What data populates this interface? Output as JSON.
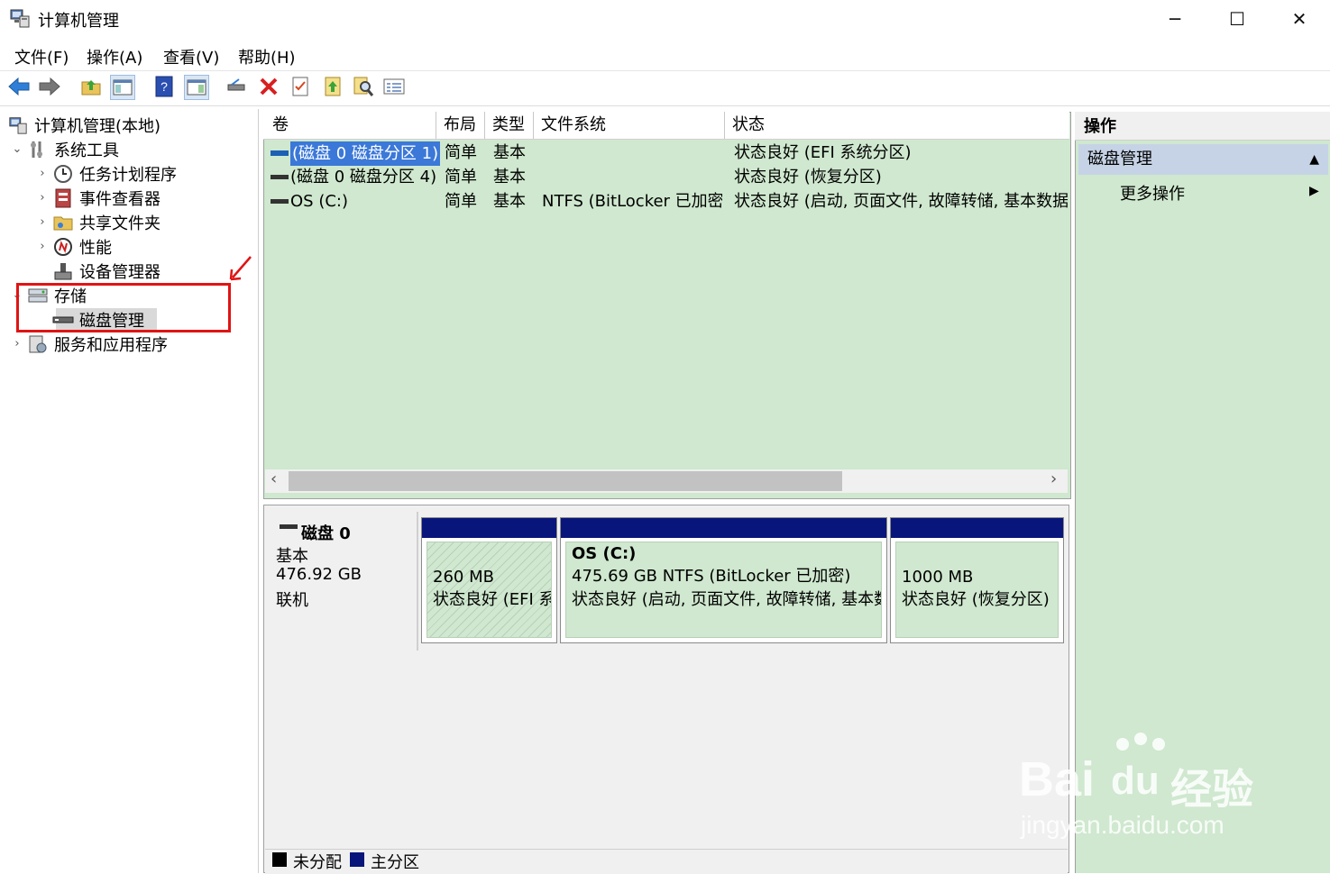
{
  "window": {
    "title": "计算机管理",
    "controls": {
      "minimize": "─",
      "maximize": "☐",
      "close": "✕"
    }
  },
  "menu": [
    "文件(F)",
    "操作(A)",
    "查看(V)",
    "帮助(H)"
  ],
  "toolbar": [
    "back-arrow",
    "forward-arrow",
    "up-folder",
    "show-hide-tree",
    "help",
    "show-hide-action",
    "connect-drive",
    "delete",
    "properties",
    "export",
    "search",
    "list-view"
  ],
  "tree": {
    "root": "计算机管理(本地)",
    "items": [
      {
        "label": "系统工具",
        "chevron": "⌄",
        "icon": "tools-icon"
      },
      {
        "label": "任务计划程序",
        "chevron": "›",
        "icon": "clock-icon"
      },
      {
        "label": "事件查看器",
        "chevron": "›",
        "icon": "event-viewer-icon"
      },
      {
        "label": "共享文件夹",
        "chevron": "›",
        "icon": "shared-folder-icon"
      },
      {
        "label": "性能",
        "chevron": "›",
        "icon": "performance-icon"
      },
      {
        "label": "设备管理器",
        "chevron": "",
        "icon": "device-manager-icon"
      },
      {
        "label": "存储",
        "chevron": "⌄",
        "icon": "storage-icon"
      },
      {
        "label": "磁盘管理",
        "chevron": "",
        "icon": "disk-icon",
        "selected": true
      },
      {
        "label": "服务和应用程序",
        "chevron": "›",
        "icon": "services-icon"
      }
    ],
    "annotation_color": "#e01414"
  },
  "columns": [
    "卷",
    "布局",
    "类型",
    "文件系统",
    "状态"
  ],
  "volumes": [
    {
      "volume": "(磁盘 0 磁盘分区 1)",
      "layout": "简单",
      "type": "基本",
      "fs": "",
      "status": "状态良好 (EFI 系统分区)",
      "selected": true
    },
    {
      "volume": "(磁盘 0 磁盘分区 4)",
      "layout": "简单",
      "type": "基本",
      "fs": "",
      "status": "状态良好 (恢复分区)"
    },
    {
      "volume": "OS (C:)",
      "layout": "简单",
      "type": "基本",
      "fs": "NTFS (BitLocker 已加密)",
      "status": "状态良好 (启动, 页面文件, 故障转储, 基本数据分区)"
    }
  ],
  "scroll": {
    "left": "‹",
    "right": "›"
  },
  "disk": {
    "name": "磁盘 0",
    "type": "基本",
    "size": "476.92 GB",
    "state": "联机",
    "partitions": [
      {
        "title": "",
        "size": "260 MB",
        "status": "状态良好 (EFI 系统分区)",
        "hatched": true
      },
      {
        "title": "OS  (C:)",
        "size": "475.69 GB NTFS (BitLocker 已加密)",
        "status": "状态良好 (启动, 页面文件, 故障转储, 基本数据分区)"
      },
      {
        "title": "",
        "size": "1000 MB",
        "status": "状态良好 (恢复分区)"
      }
    ]
  },
  "legend": [
    {
      "label": "未分配",
      "color": "#000000"
    },
    {
      "label": "主分区",
      "color": "#08157a"
    }
  ],
  "actions": {
    "header": "操作",
    "section": "磁盘管理",
    "section_arrow": "▲",
    "more": "更多操作",
    "more_arrow": "▶"
  },
  "watermark": {
    "brand": "Bai",
    "paw": "du",
    "cn": "经验",
    "url": "jingyan.baidu.com"
  },
  "colors": {
    "list_bg": "#cfe8cf",
    "selected_bg": "#3b78d8",
    "partition_header": "#08157a"
  }
}
